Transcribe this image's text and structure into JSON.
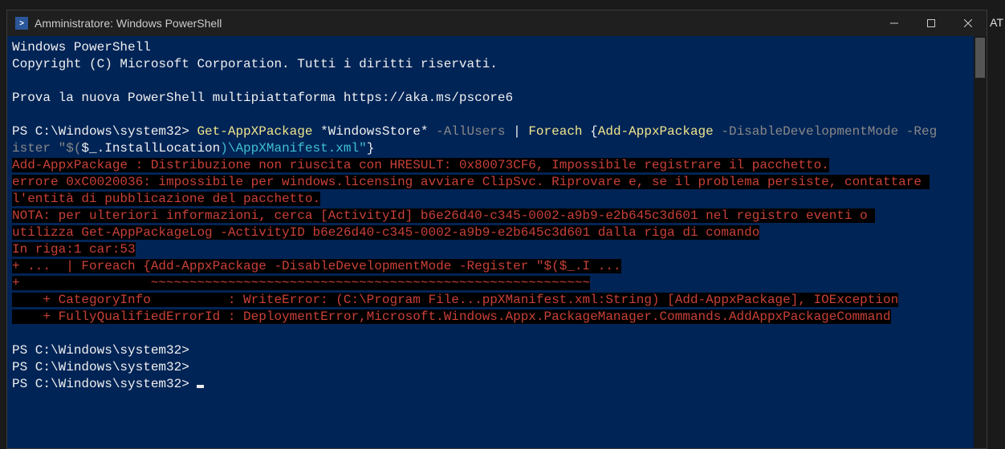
{
  "window": {
    "title": "Amministratore: Windows PowerShell"
  },
  "background": {
    "right_text": "AT"
  },
  "lines": {
    "l1": "Windows PowerShell",
    "l2": "Copyright (C) Microsoft Corporation. Tutti i diritti riservati.",
    "l3": "",
    "l4": "Prova la nuova PowerShell multipiattaforma https://aka.ms/pscore6",
    "l5": "",
    "prompt1_a": "PS C:\\Windows\\system32> ",
    "prompt1_cmd1": "Get-AppXPackage",
    "prompt1_star": " *WindowsStore* ",
    "prompt1_param1": "-AllUsers ",
    "prompt1_pipe": "| ",
    "prompt1_foreach": "Foreach ",
    "prompt1_brace": "{",
    "prompt1_cmd2": "Add-AppxPackage",
    "prompt1_param2": " -DisableDevelopmentMode -Reg",
    "prompt1_cont": "ister ",
    "prompt1_q1": "\"$(",
    "prompt1_var": "$_",
    "prompt1_prop": ".InstallLocation",
    "prompt1_path": ")\\AppXManifest.xml\"",
    "prompt1_close": "}",
    "err1": "Add-AppxPackage : Distribuzione non riuscita con HRESULT: 0x80073CF6, Impossibile registrare il pacchetto.",
    "err2": "errore 0xC0020036: impossibile per windows.licensing avviare ClipSvc. Riprovare e, se il problema persiste, contattare ",
    "err3": "l'entità di pubblicazione del pacchetto.",
    "err4": "NOTA: per ulteriori informazioni, cerca [ActivityId] b6e26d40-c345-0002-a9b9-e2b645c3d601 nel registro eventi o ",
    "err5": "utilizza Get-AppPackageLog -ActivityID b6e26d40-c345-0002-a9b9-e2b645c3d601 dalla riga di comando",
    "err6": "In riga:1 car:53",
    "err7": "+ ...  | Foreach {Add-AppxPackage -DisableDevelopmentMode -Register \"$($_.I ...",
    "err8": "+                 ~~~~~~~~~~~~~~~~~~~~~~~~~~~~~~~~~~~~~~~~~~~~~~~~~~~~~~~~~",
    "err9": "    + CategoryInfo          : WriteError: (C:\\Program File...ppXManifest.xml:String) [Add-AppxPackage], IOException",
    "err10": "    + FullyQualifiedErrorId : DeploymentError,Microsoft.Windows.Appx.PackageManager.Commands.AddAppxPackageCommand",
    "blank": " ",
    "prompt2": "PS C:\\Windows\\system32>",
    "prompt3": "PS C:\\Windows\\system32>",
    "prompt4": "PS C:\\Windows\\system32> "
  }
}
